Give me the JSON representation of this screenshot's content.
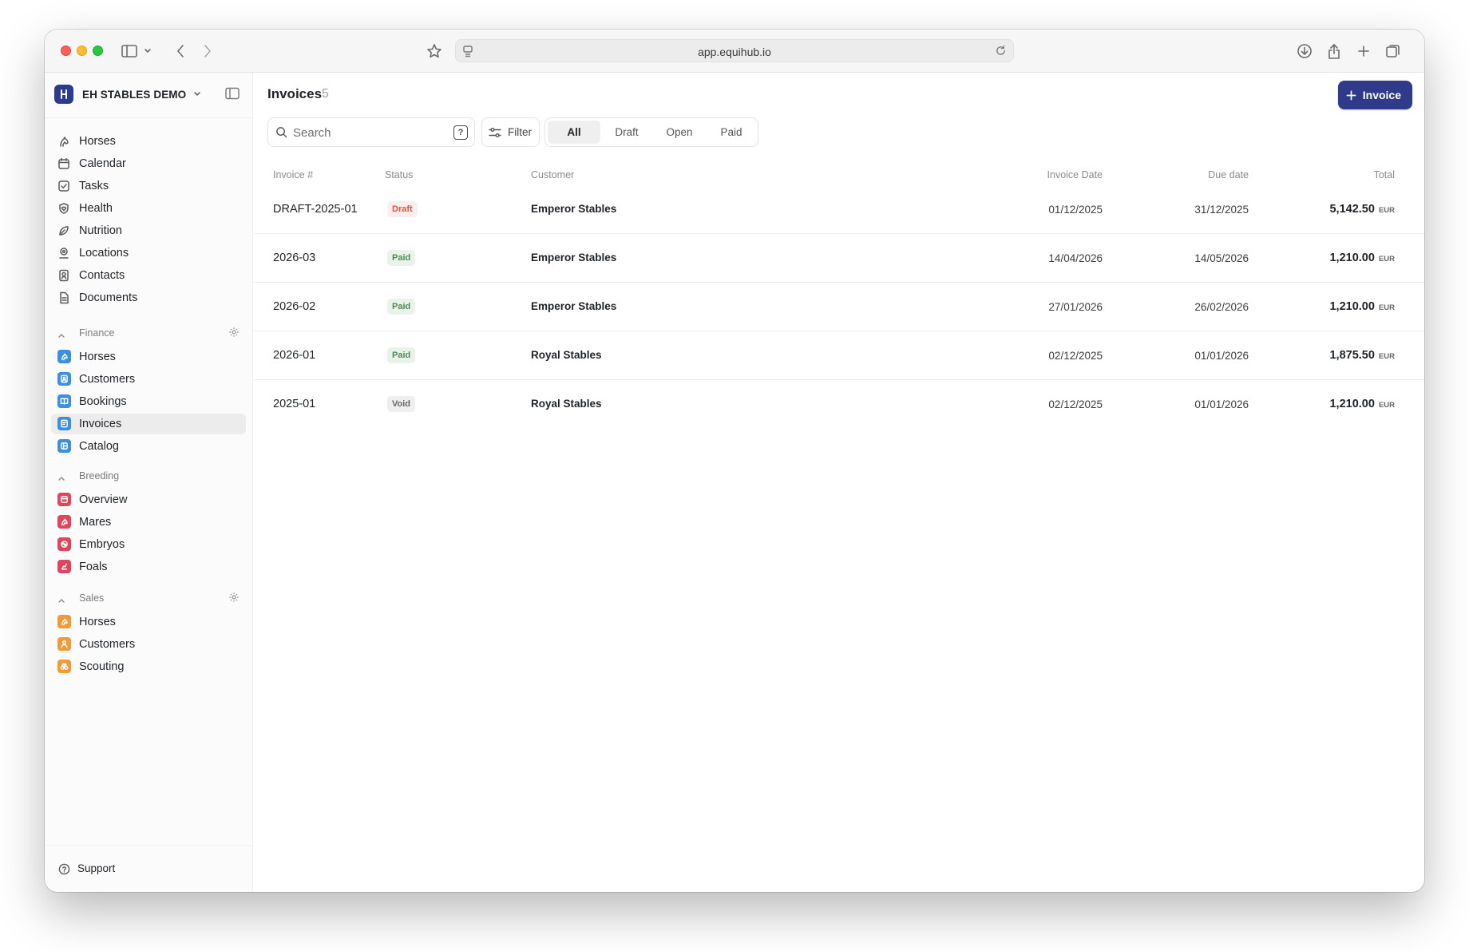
{
  "browser": {
    "url": "app.equihub.io"
  },
  "sidebar": {
    "org_name": "EH STABLES DEMO",
    "main_items": [
      {
        "label": "Horses",
        "icon": "horse-icon"
      },
      {
        "label": "Calendar",
        "icon": "calendar-icon"
      },
      {
        "label": "Tasks",
        "icon": "tasks-icon"
      },
      {
        "label": "Health",
        "icon": "health-icon"
      },
      {
        "label": "Nutrition",
        "icon": "nutrition-icon"
      },
      {
        "label": "Locations",
        "icon": "location-icon"
      },
      {
        "label": "Contacts",
        "icon": "contacts-icon"
      },
      {
        "label": "Documents",
        "icon": "documents-icon"
      }
    ],
    "finance": {
      "label": "Finance",
      "items": [
        {
          "label": "Horses"
        },
        {
          "label": "Customers"
        },
        {
          "label": "Bookings"
        },
        {
          "label": "Invoices",
          "active": true
        },
        {
          "label": "Catalog"
        }
      ]
    },
    "breeding": {
      "label": "Breeding",
      "items": [
        {
          "label": "Overview"
        },
        {
          "label": "Mares"
        },
        {
          "label": "Embryos"
        },
        {
          "label": "Foals"
        }
      ]
    },
    "sales": {
      "label": "Sales",
      "items": [
        {
          "label": "Horses"
        },
        {
          "label": "Customers"
        },
        {
          "label": "Scouting"
        }
      ]
    },
    "support_label": "Support"
  },
  "colors": {
    "primary_button": "#2f3a8a",
    "finance_accent": "#3b8fdc",
    "breeding_accent": "#e2445c",
    "sales_accent": "#f29a36"
  },
  "main": {
    "title": "Invoices",
    "count": "5",
    "new_button_label": "Invoice",
    "search_placeholder": "Search",
    "filter_label": "Filter",
    "tabs": [
      "All",
      "Draft",
      "Open",
      "Paid"
    ],
    "active_tab": "All",
    "columns": {
      "invoice": "Invoice #",
      "status": "Status",
      "customer": "Customer",
      "invoice_date": "Invoice Date",
      "due_date": "Due date",
      "total": "Total"
    },
    "rows": [
      {
        "number": "DRAFT-2025-01",
        "status": "Draft",
        "customer": "Emperor Stables",
        "invoice_date": "01/12/2025",
        "due_date": "31/12/2025",
        "total": "5,142.50",
        "currency": "EUR"
      },
      {
        "number": "2026-03",
        "status": "Paid",
        "customer": "Emperor Stables",
        "invoice_date": "14/04/2026",
        "due_date": "14/05/2026",
        "total": "1,210.00",
        "currency": "EUR"
      },
      {
        "number": "2026-02",
        "status": "Paid",
        "customer": "Emperor Stables",
        "invoice_date": "27/01/2026",
        "due_date": "26/02/2026",
        "total": "1,210.00",
        "currency": "EUR"
      },
      {
        "number": "2026-01",
        "status": "Paid",
        "customer": "Royal Stables",
        "invoice_date": "02/12/2025",
        "due_date": "01/01/2026",
        "total": "1,875.50",
        "currency": "EUR"
      },
      {
        "number": "2025-01",
        "status": "Void",
        "customer": "Royal Stables",
        "invoice_date": "02/12/2025",
        "due_date": "01/01/2026",
        "total": "1,210.00",
        "currency": "EUR"
      }
    ]
  }
}
